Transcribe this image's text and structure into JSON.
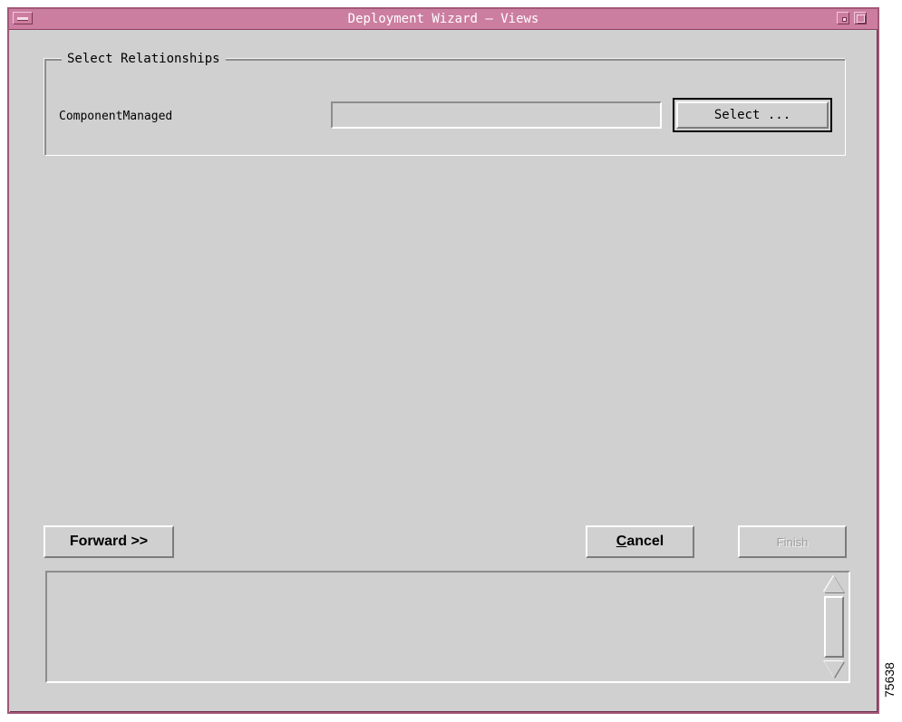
{
  "window": {
    "title": "Deployment Wizard — Views",
    "title_color": "#cc7ea0"
  },
  "relationships": {
    "group_label": "Select Relationships",
    "items": [
      {
        "label": "ComponentManaged",
        "value": "",
        "button_label": "Select ..."
      }
    ]
  },
  "footer": {
    "forward_label": "Forward >>",
    "cancel_mnemonic": "C",
    "cancel_rest": "ancel",
    "finish_label": "Finish",
    "finish_enabled": false
  },
  "log": {
    "text": ""
  },
  "figure_number": "75638",
  "icons": [
    "window-menu-icon",
    "minimize-icon",
    "maximize-icon",
    "scroll-up-arrow-icon",
    "scroll-down-arrow-icon"
  ]
}
